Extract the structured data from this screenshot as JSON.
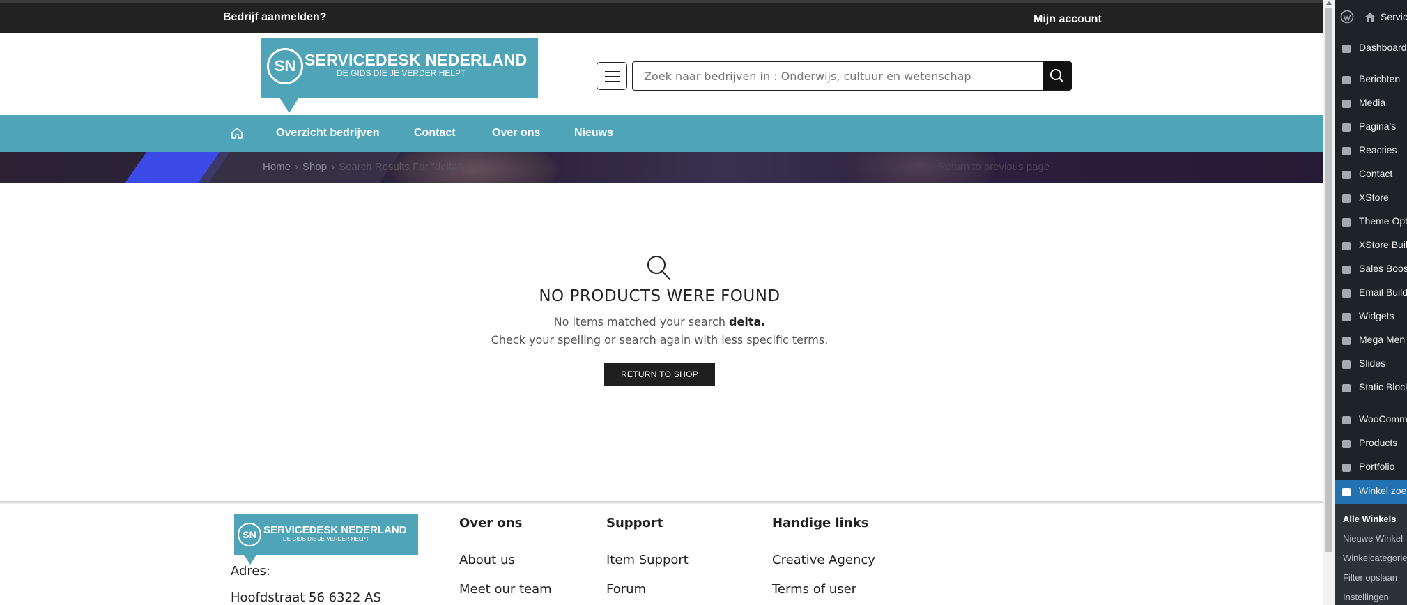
{
  "topbar": {
    "left_link": "Bedrijf aanmelden?",
    "right_link": "Mijn account"
  },
  "logo": {
    "initials": "SN",
    "name": "SERVICEDESK NEDERLAND",
    "tagline": "DE GIDS DIE JE VERDER HELPT"
  },
  "search": {
    "placeholder": "Zoek naar bedrijven in : Onderwijs, cultuur en wetenschap",
    "value": ""
  },
  "nav": {
    "items": [
      "Overzicht bedrijven",
      "Contact",
      "Over ons",
      "Nieuws"
    ]
  },
  "breadcrumb": {
    "home": "Home",
    "shop": "Shop",
    "current": "Search Results For \"delta\"",
    "return": "Return to previous page"
  },
  "results": {
    "title": "NO PRODUCTS WERE FOUND",
    "line1_prefix": "No items matched your search",
    "line1_term": "delta.",
    "line2": "Check your spelling or search again with less specific terms.",
    "button": "RETURN TO SHOP"
  },
  "footer": {
    "address_label": "Adres:",
    "address_line": "Hoofdstraat 56 6322 AS",
    "col1": {
      "title": "Over ons",
      "links": [
        "About us",
        "Meet our team"
      ]
    },
    "col2": {
      "title": "Support",
      "links": [
        "Item Support",
        "Forum"
      ]
    },
    "col3": {
      "title": "Handige links",
      "links": [
        "Creative Agency",
        "Terms of user"
      ]
    }
  },
  "wp_admin": {
    "site": "Servic",
    "menu": [
      {
        "label": "Dashboard",
        "icon": "dashboard-icon"
      },
      {
        "label": "Berichten",
        "icon": "pin-icon"
      },
      {
        "label": "Media",
        "icon": "media-icon"
      },
      {
        "label": "Pagina's",
        "icon": "pages-icon"
      },
      {
        "label": "Reacties",
        "icon": "comments-icon"
      },
      {
        "label": "Contact",
        "icon": "mail-icon"
      },
      {
        "label": "XStore",
        "icon": "xstore-icon"
      },
      {
        "label": "Theme Opt",
        "icon": "theme-options-icon"
      },
      {
        "label": "XStore Buil",
        "icon": "builder-icon"
      },
      {
        "label": "Sales Boost",
        "icon": "chart-icon"
      },
      {
        "label": "Email Build",
        "icon": "mail-icon"
      },
      {
        "label": "Widgets",
        "icon": "widgets-icon"
      },
      {
        "label": "Mega Men",
        "icon": "mega-menu-icon"
      },
      {
        "label": "Slides",
        "icon": "slides-icon"
      },
      {
        "label": "Static Block",
        "icon": "blocks-icon"
      },
      {
        "label": "WooComm",
        "icon": "woo-icon"
      },
      {
        "label": "Products",
        "icon": "archive-icon"
      },
      {
        "label": "Portfolio",
        "icon": "portfolio-icon"
      },
      {
        "label": "Winkel zoe",
        "icon": "store-icon"
      }
    ],
    "submenu": [
      "Alle Winkels",
      "Nieuwe Winkel",
      "Winkelcategorie",
      "Filter opslaan",
      "Instellingen"
    ]
  },
  "colors": {
    "brand": "#4fa4b7",
    "topbar": "#222222",
    "wp_sidebar": "#1d2327",
    "wp_active": "#2271b1"
  }
}
